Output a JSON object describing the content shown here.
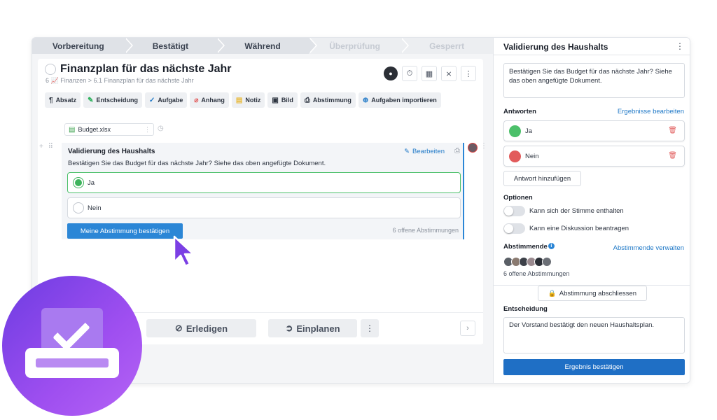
{
  "stepper": [
    "Vorbereitung",
    "Bestätigt",
    "Während",
    "Überprüfung",
    "Gesperrt"
  ],
  "main": {
    "title": "Finanzplan für das nächste Jahr",
    "breadcrumb": "6 📈 Finanzen > 6.1 Finanzplan für das nächste Jahr",
    "toolbar": [
      {
        "icon": "¶",
        "label": "Absatz"
      },
      {
        "icon": "✎",
        "label": "Entscheidung"
      },
      {
        "icon": "✓",
        "label": "Aufgabe"
      },
      {
        "icon": "⌀",
        "label": "Anhang"
      },
      {
        "icon": "▤",
        "label": "Notiz"
      },
      {
        "icon": "▣",
        "label": "Bild"
      },
      {
        "icon": "⎙",
        "label": "Abstimmung"
      },
      {
        "icon": "⊕",
        "label": "Aufgaben importieren"
      }
    ],
    "file": "Budget.xlsx",
    "vote": {
      "title": "Validierung des Haushalts",
      "edit": "Bearbeiten",
      "description": "Bestätigen Sie das Budget für das nächste Jahr? Siehe das oben angefügte Dokument.",
      "options": [
        "Ja",
        "Nein"
      ],
      "confirm": "Meine Abstimmung bestätigen",
      "open": "6 offene Abstimmungen"
    },
    "bottom": {
      "done": "Erledigen",
      "schedule": "Einplanen"
    }
  },
  "panel": {
    "title": "Validierung des Haushalts",
    "question": "Bestätigen Sie das Budget für das nächste Jahr? Siehe das oben angefügte Dokument.",
    "answers_label": "Antworten",
    "edit_results": "Ergebnisse bearbeiten",
    "answers": [
      {
        "label": "Ja",
        "color": "#4cc06a"
      },
      {
        "label": "Nein",
        "color": "#e25b5b"
      }
    ],
    "add_answer": "Antwort hinzufügen",
    "options_label": "Optionen",
    "options": [
      "Kann sich der Stimme enthalten",
      "Kann eine Diskussion beantragen"
    ],
    "voters_label": "Abstimmende",
    "manage_voters": "Abstimmende verwalten",
    "voters_count": "6 offene Abstimmungen",
    "close_vote": "Abstimmung abschliessen",
    "decision_label": "Entscheidung",
    "decision": "Der Vorstand bestätigt den neuen Haushaltsplan.",
    "confirm_result": "Ergebnis bestätigen"
  }
}
